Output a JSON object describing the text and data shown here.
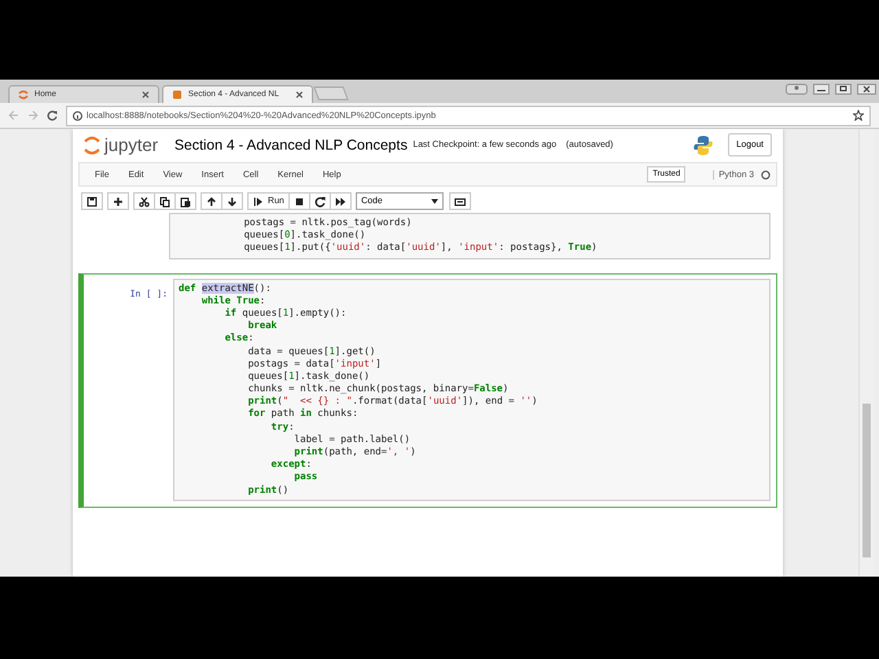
{
  "browser": {
    "tabs": [
      {
        "title": "Home",
        "selected": false
      },
      {
        "title": "Section 4 - Advanced NL",
        "selected": true
      }
    ],
    "url": "localhost:8888/notebooks/Section%204%20-%20Advanced%20NLP%20Concepts.ipynb"
  },
  "header": {
    "logo_text": "jupyter",
    "notebook_title": "Section 4 - Advanced NLP Concepts",
    "checkpoint": "Last Checkpoint: a few seconds ago",
    "autosave": "(autosaved)",
    "logout": "Logout"
  },
  "menu": {
    "items": [
      "File",
      "Edit",
      "View",
      "Insert",
      "Cell",
      "Kernel",
      "Help"
    ],
    "trusted": "Trusted",
    "kernel": "Python 3"
  },
  "toolbar": {
    "run": "Run",
    "cell_type": "Code"
  },
  "cells": [
    {
      "selected": false,
      "lines": [
        [
          {
            "text": "            postags = nltk.pos_tag(words)",
            "kind": "plain"
          }
        ],
        [
          {
            "text": "            queues[",
            "kind": "plain"
          },
          {
            "text": "0",
            "kind": "number"
          },
          {
            "text": "].task_done()",
            "kind": "plain"
          }
        ],
        [
          {
            "text": "            queues[",
            "kind": "plain"
          },
          {
            "text": "1",
            "kind": "number"
          },
          {
            "text": "].put({",
            "kind": "plain"
          },
          {
            "text": "'uuid'",
            "kind": "string"
          },
          {
            "text": ": data[",
            "kind": "plain"
          },
          {
            "text": "'uuid'",
            "kind": "string"
          },
          {
            "text": "], ",
            "kind": "plain"
          },
          {
            "text": "'input'",
            "kind": "string"
          },
          {
            "text": ": postags}, ",
            "kind": "plain"
          },
          {
            "text": "True",
            "kind": "keyword"
          },
          {
            "text": ")",
            "kind": "plain"
          }
        ]
      ]
    },
    {
      "selected": true,
      "prompt": "In [ ]:",
      "lines": [
        [
          {
            "text": "def ",
            "kind": "keyword"
          },
          {
            "text": "extractNE",
            "kind": "highlight"
          },
          {
            "text": "():",
            "kind": "plain"
          }
        ],
        [
          {
            "text": "    while True",
            "kind": "keyword"
          },
          {
            "text": ":",
            "kind": "plain"
          }
        ],
        [
          {
            "text": "        if",
            "kind": "keyword"
          },
          {
            "text": " queues[",
            "kind": "plain"
          },
          {
            "text": "1",
            "kind": "number"
          },
          {
            "text": "].empty():",
            "kind": "plain"
          }
        ],
        [
          {
            "text": "            break",
            "kind": "keyword"
          }
        ],
        [
          {
            "text": "        else",
            "kind": "keyword"
          },
          {
            "text": ":",
            "kind": "plain"
          }
        ],
        [
          {
            "text": "            data = queues[",
            "kind": "plain"
          },
          {
            "text": "1",
            "kind": "number"
          },
          {
            "text": "].get()",
            "kind": "plain"
          }
        ],
        [
          {
            "text": "            postags = data[",
            "kind": "plain"
          },
          {
            "text": "'input'",
            "kind": "string"
          },
          {
            "text": "]",
            "kind": "plain"
          }
        ],
        [
          {
            "text": "            queues[",
            "kind": "plain"
          },
          {
            "text": "1",
            "kind": "number"
          },
          {
            "text": "].task_done()",
            "kind": "plain"
          }
        ],
        [
          {
            "text": "            chunks = nltk.ne_chunk(postags, binary=",
            "kind": "plain"
          },
          {
            "text": "False",
            "kind": "keyword"
          },
          {
            "text": ")",
            "kind": "plain"
          }
        ],
        [
          {
            "text": "            print",
            "kind": "keyword"
          },
          {
            "text": "(",
            "kind": "plain"
          },
          {
            "text": "\"  << {} : \"",
            "kind": "string"
          },
          {
            "text": ".format(data[",
            "kind": "plain"
          },
          {
            "text": "'uuid'",
            "kind": "string"
          },
          {
            "text": "]), end = ",
            "kind": "plain"
          },
          {
            "text": "''",
            "kind": "string"
          },
          {
            "text": ")",
            "kind": "plain"
          }
        ],
        [
          {
            "text": "            for",
            "kind": "keyword"
          },
          {
            "text": " path ",
            "kind": "plain"
          },
          {
            "text": "in",
            "kind": "keyword"
          },
          {
            "text": " chunks:",
            "kind": "plain"
          }
        ],
        [
          {
            "text": "                try",
            "kind": "keyword"
          },
          {
            "text": ":",
            "kind": "plain"
          }
        ],
        [
          {
            "text": "                    label = path.label()",
            "kind": "plain"
          }
        ],
        [
          {
            "text": "                    print",
            "kind": "keyword"
          },
          {
            "text": "(path, end=",
            "kind": "plain"
          },
          {
            "text": "', '",
            "kind": "string"
          },
          {
            "text": ")",
            "kind": "plain"
          }
        ],
        [
          {
            "text": "                except",
            "kind": "keyword"
          },
          {
            "text": ":",
            "kind": "plain"
          }
        ],
        [
          {
            "text": "                    pass",
            "kind": "keyword"
          }
        ],
        [
          {
            "text": "            print",
            "kind": "keyword"
          },
          {
            "text": "()",
            "kind": "plain"
          }
        ]
      ]
    }
  ]
}
